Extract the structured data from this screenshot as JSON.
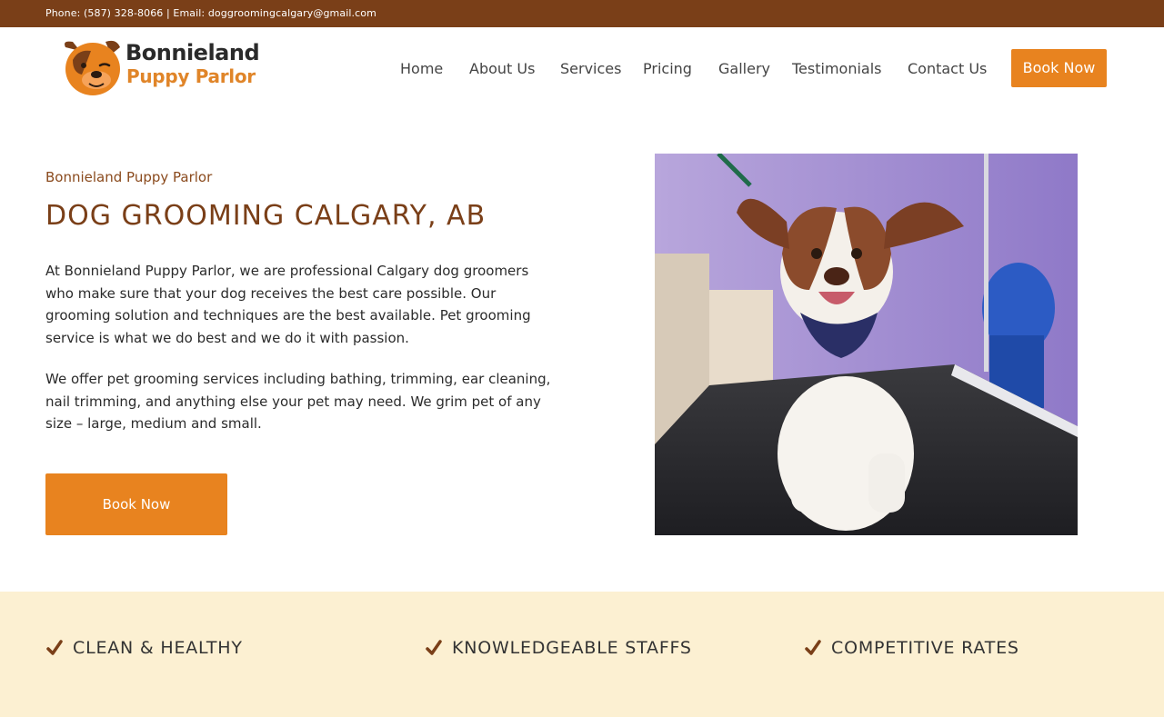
{
  "topbar": {
    "contact": "Phone: (587) 328-8066 | Email: doggroomingcalgary@gmail.com"
  },
  "logo": {
    "line1": "Bonnieland",
    "line2": "Puppy Parlor"
  },
  "nav": {
    "items": [
      "Home",
      "About Us",
      "Services",
      "Pricing",
      "Gallery",
      "Testimonials",
      "Contact Us"
    ],
    "book_label": "Book Now"
  },
  "hero": {
    "eyebrow": "Bonnieland Puppy Parlor",
    "title": "DOG GROOMING CALGARY, AB",
    "paragraph1": "At Bonnieland Puppy Parlor, we are professional Calgary dog groomers who make sure that your dog receives the best care possible. Our grooming solution and techniques are the best available. Pet grooming service is what we do best and we do it with passion.",
    "paragraph2": "We offer pet grooming services including bathing, trimming, ear cleaning, nail trimming, and anything else your pet may need. We grim pet of any size – large, medium and small.",
    "button_label": "Book Now",
    "image_icon": "puppy-photo"
  },
  "features": [
    {
      "label": "CLEAN & HEALTHY",
      "icon": "check-icon"
    },
    {
      "label": "KNOWLEDGEABLE STAFFS",
      "icon": "check-icon"
    },
    {
      "label": "COMPETITIVE RATES",
      "icon": "check-icon"
    }
  ],
  "colors": {
    "topbar": "#7a3f18",
    "accent": "#e8831f",
    "title": "#7a3f18",
    "features_bg": "#fcf0d2"
  }
}
